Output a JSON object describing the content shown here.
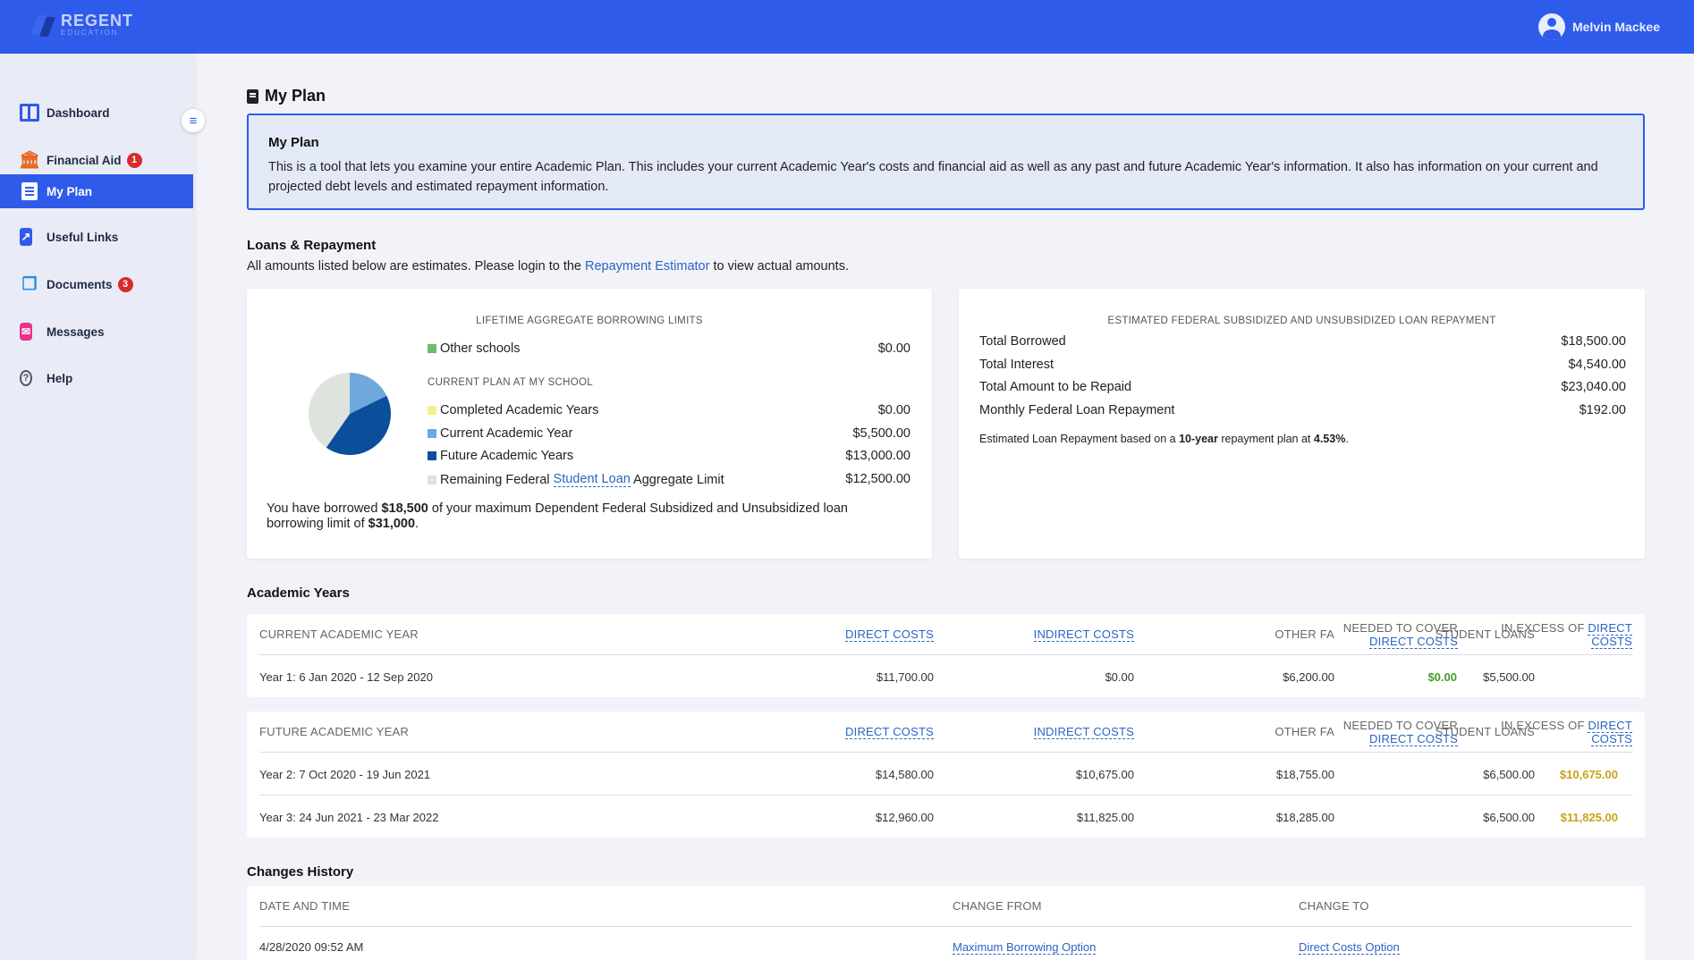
{
  "header": {
    "brand": "REGENT",
    "brand_sub": "EDUCATION",
    "user_name": "Melvin Mackee"
  },
  "sidebar": {
    "items": [
      {
        "label": "Dashboard",
        "icon": "dashboard-icon"
      },
      {
        "label": "Financial Aid",
        "icon": "bank-icon",
        "badge": "1"
      },
      {
        "label": "My Plan",
        "icon": "plan-icon",
        "active": true
      },
      {
        "label": "Useful Links",
        "icon": "external-link-icon"
      },
      {
        "label": "Documents",
        "icon": "documents-icon",
        "badge": "3"
      },
      {
        "label": "Messages",
        "icon": "messages-icon"
      },
      {
        "label": "Help",
        "icon": "help-icon"
      }
    ]
  },
  "page": {
    "title": "My Plan",
    "info_title": "My Plan",
    "info_text": "This is a tool that lets you examine your entire Academic Plan. This includes your current Academic Year's costs and financial aid as well as any past and future Academic Year's information. It also has information on your current and projected debt levels and estimated repayment information."
  },
  "loans": {
    "title": "Loans & Repayment",
    "sub_before": "All amounts listed below are estimates. Please login to the ",
    "sub_link": "Repayment Estimator",
    "sub_after": " to view actual amounts.",
    "limits_heading": "LIFETIME AGGREGATE BORROWING LIMITS",
    "other_schools_label": "Other schools",
    "other_schools_value": "$0.00",
    "current_plan_heading": "CURRENT PLAN AT MY SCHOOL",
    "legend": [
      {
        "label": "Completed Academic Years",
        "value": "$0.00",
        "color": "#f4ef8c"
      },
      {
        "label": "Current Academic Year",
        "value": "$5,500.00",
        "color": "#6fa8dc"
      },
      {
        "label": "Future Academic Years",
        "value": "$13,000.00",
        "color": "#0b4f9c"
      }
    ],
    "remaining_prefix": "Remaining Federal ",
    "remaining_link": "Student Loan",
    "remaining_suffix": " Aggregate Limit",
    "remaining_value": "$12,500.00",
    "remaining_color": "#dfe3de",
    "other_schools_color": "#6cbf6a",
    "borrowed_prefix": "You have borrowed ",
    "borrowed_amount": "$18,500",
    "borrowed_middle": " of your maximum Dependent Federal Subsidized and Unsubsidized loan borrowing limit of ",
    "borrowed_limit": "$31,000",
    "borrowed_end": ".",
    "pie": [
      {
        "name": "Current Academic Year",
        "value": 5500,
        "color": "#6fa8dc"
      },
      {
        "name": "Future Academic Years",
        "value": 13000,
        "color": "#0b4f9c"
      },
      {
        "name": "Remaining Federal Student Loan Aggregate Limit",
        "value": 12500,
        "color": "#dfe3de"
      }
    ]
  },
  "repayment": {
    "heading": "ESTIMATED FEDERAL SUBSIDIZED AND UNSUBSIDIZED LOAN REPAYMENT",
    "rows": [
      {
        "label": "Total Borrowed",
        "value": "$18,500.00"
      },
      {
        "label": "Total Interest",
        "value": "$4,540.00"
      },
      {
        "label": "Total Amount to be Repaid",
        "value": "$23,040.00"
      },
      {
        "label": "Monthly Federal Loan Repayment",
        "value": "$192.00"
      }
    ],
    "note_prefix": "Estimated Loan Repayment based on a ",
    "note_term": "10-year",
    "note_middle": " repayment plan at ",
    "note_rate": "4.53%",
    "note_end": "."
  },
  "academic_years": {
    "title": "Academic Years",
    "columns": {
      "direct_costs": "DIRECT COSTS",
      "indirect_costs": "INDIRECT COSTS",
      "other_fa": "OTHER FA",
      "student_loans": "STUDENT LOANS",
      "needed_to_cover": "NEEDED TO COVER",
      "in_excess_of": "IN EXCESS OF",
      "direct_1": "DIRECT",
      "costs_1": "COSTS"
    },
    "current": {
      "heading": "CURRENT ACADEMIC YEAR",
      "rows": [
        {
          "label": "Year 1: 6 Jan 2020 - 12 Sep 2020",
          "direct": "$11,700.00",
          "indirect": "$0.00",
          "other_fa": "$6,200.00",
          "loans": "$5,500.00",
          "needed": "$0.00",
          "excess": ""
        }
      ]
    },
    "future": {
      "heading": "FUTURE ACADEMIC YEAR",
      "rows": [
        {
          "label": "Year 2: 7 Oct 2020 - 19 Jun 2021",
          "direct": "$14,580.00",
          "indirect": "$10,675.00",
          "other_fa": "$18,755.00",
          "loans": "$6,500.00",
          "needed": "",
          "excess": "$10,675.00"
        },
        {
          "label": "Year 3: 24 Jun 2021 - 23 Mar 2022",
          "direct": "$12,960.00",
          "indirect": "$11,825.00",
          "other_fa": "$18,285.00",
          "loans": "$6,500.00",
          "needed": "",
          "excess": "$11,825.00"
        }
      ]
    }
  },
  "history": {
    "title": "Changes History",
    "col_date": "DATE AND TIME",
    "col_from": "CHANGE FROM",
    "col_to": "CHANGE TO",
    "rows": [
      {
        "date": "4/28/2020 09:52 AM",
        "from": "Maximum Borrowing Option",
        "to": "Direct Costs Option"
      }
    ]
  }
}
